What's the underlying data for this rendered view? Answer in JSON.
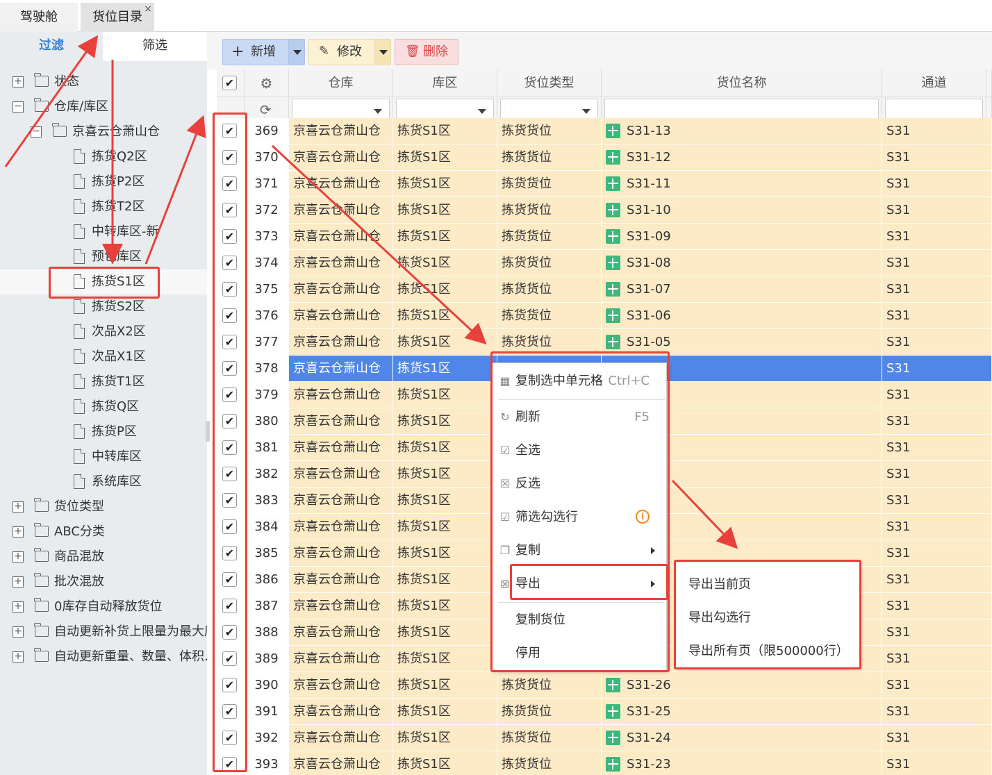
{
  "tabs": [
    {
      "label": "驾驶舱"
    },
    {
      "label": "货位目录",
      "close": "×"
    }
  ],
  "left_tabs": {
    "filter": "过滤",
    "screen": "筛选"
  },
  "tree": [
    {
      "label": "状态",
      "toggle": "⊞",
      "type": "folder",
      "level": 0
    },
    {
      "label": "仓库/库区",
      "toggle": "⊟",
      "type": "folder-open",
      "level": 0
    },
    {
      "label": "京喜云仓萧山仓",
      "toggle": "⊟",
      "type": "folder-open",
      "level": 1
    },
    {
      "label": "拣货Q2区",
      "type": "doc",
      "level": 2
    },
    {
      "label": "拣货P2区",
      "type": "doc",
      "level": 2
    },
    {
      "label": "拣货T2区",
      "type": "doc",
      "level": 2
    },
    {
      "label": "中转库区-新",
      "type": "doc",
      "level": 2
    },
    {
      "label": "预包库区",
      "type": "doc",
      "level": 2
    },
    {
      "label": "拣货S1区",
      "type": "doc",
      "level": 2,
      "selected": true
    },
    {
      "label": "拣货S2区",
      "type": "doc",
      "level": 2
    },
    {
      "label": "次品X2区",
      "type": "doc",
      "level": 2
    },
    {
      "label": "次品X1区",
      "type": "doc",
      "level": 2
    },
    {
      "label": "拣货T1区",
      "type": "doc",
      "level": 2
    },
    {
      "label": "拣货Q区",
      "type": "doc",
      "level": 2
    },
    {
      "label": "拣货P区",
      "type": "doc",
      "level": 2
    },
    {
      "label": "中转库区",
      "type": "doc",
      "level": 2
    },
    {
      "label": "系统库区",
      "type": "doc",
      "level": 2
    },
    {
      "label": "货位类型",
      "toggle": "⊞",
      "type": "folder",
      "level": 0
    },
    {
      "label": "ABC分类",
      "toggle": "⊞",
      "type": "folder",
      "level": 0
    },
    {
      "label": "商品混放",
      "toggle": "⊞",
      "type": "folder",
      "level": 0
    },
    {
      "label": "批次混放",
      "toggle": "⊞",
      "type": "folder",
      "level": 0
    },
    {
      "label": "0库存自动释放货位",
      "toggle": "⊞",
      "type": "folder",
      "level": 0
    },
    {
      "label": "自动更新补货上限量为最大库存",
      "toggle": "⊞",
      "type": "folder",
      "level": 0
    },
    {
      "label": "自动更新重量、数量、体积…",
      "toggle": "⊞",
      "type": "folder",
      "level": 0
    }
  ],
  "toolbar": {
    "add": "新增",
    "edit": "修改",
    "delete": "删除"
  },
  "columns": {
    "warehouse": "仓库",
    "zone": "库区",
    "slot_type": "货位类型",
    "slot_name": "货位名称",
    "channel": "通道"
  },
  "rows": [
    {
      "n": "369",
      "w": "京喜云仓萧山仓",
      "z": "拣货S1区",
      "t": "拣货货位",
      "name": "S31-13",
      "ch": "S31"
    },
    {
      "n": "370",
      "w": "京喜云仓萧山仓",
      "z": "拣货S1区",
      "t": "拣货货位",
      "name": "S31-12",
      "ch": "S31"
    },
    {
      "n": "371",
      "w": "京喜云仓萧山仓",
      "z": "拣货S1区",
      "t": "拣货货位",
      "name": "S31-11",
      "ch": "S31"
    },
    {
      "n": "372",
      "w": "京喜云仓萧山仓",
      "z": "拣货S1区",
      "t": "拣货货位",
      "name": "S31-10",
      "ch": "S31"
    },
    {
      "n": "373",
      "w": "京喜云仓萧山仓",
      "z": "拣货S1区",
      "t": "拣货货位",
      "name": "S31-09",
      "ch": "S31"
    },
    {
      "n": "374",
      "w": "京喜云仓萧山仓",
      "z": "拣货S1区",
      "t": "拣货货位",
      "name": "S31-08",
      "ch": "S31"
    },
    {
      "n": "375",
      "w": "京喜云仓萧山仓",
      "z": "拣货S1区",
      "t": "拣货货位",
      "name": "S31-07",
      "ch": "S31"
    },
    {
      "n": "376",
      "w": "京喜云仓萧山仓",
      "z": "拣货S1区",
      "t": "拣货货位",
      "name": "S31-06",
      "ch": "S31"
    },
    {
      "n": "377",
      "w": "京喜云仓萧山仓",
      "z": "拣货S1区",
      "t": "拣货货位",
      "name": "S31-05",
      "ch": "S31"
    },
    {
      "n": "378",
      "w": "京喜云仓萧山仓",
      "z": "拣货S1区",
      "t": "",
      "name": "",
      "ch": "S31",
      "highlight": true
    },
    {
      "n": "379",
      "w": "京喜云仓萧山仓",
      "z": "拣货S1区",
      "t": "",
      "name": "",
      "ch": "S31"
    },
    {
      "n": "380",
      "w": "京喜云仓萧山仓",
      "z": "拣货S1区",
      "t": "",
      "name": "",
      "ch": "S31"
    },
    {
      "n": "381",
      "w": "京喜云仓萧山仓",
      "z": "拣货S1区",
      "t": "",
      "name": "",
      "ch": "S31"
    },
    {
      "n": "382",
      "w": "京喜云仓萧山仓",
      "z": "拣货S1区",
      "t": "",
      "name": "",
      "ch": "S31"
    },
    {
      "n": "383",
      "w": "京喜云仓萧山仓",
      "z": "拣货S1区",
      "t": "",
      "name": "",
      "ch": "S31"
    },
    {
      "n": "384",
      "w": "京喜云仓萧山仓",
      "z": "拣货S1区",
      "t": "",
      "name": "",
      "ch": "S31"
    },
    {
      "n": "385",
      "w": "京喜云仓萧山仓",
      "z": "拣货S1区",
      "t": "",
      "name": "",
      "ch": "S31"
    },
    {
      "n": "386",
      "w": "京喜云仓萧山仓",
      "z": "拣货S1区",
      "t": "",
      "name": "",
      "ch": "S31"
    },
    {
      "n": "387",
      "w": "京喜云仓萧山仓",
      "z": "拣货S1区",
      "t": "",
      "name": "",
      "ch": "S31"
    },
    {
      "n": "388",
      "w": "京喜云仓萧山仓",
      "z": "拣货S1区",
      "t": "",
      "name": "",
      "ch": "S31"
    },
    {
      "n": "389",
      "w": "京喜云仓萧山仓",
      "z": "拣货S1区",
      "t": "",
      "name": "",
      "ch": "S31"
    },
    {
      "n": "390",
      "w": "京喜云仓萧山仓",
      "z": "拣货S1区",
      "t": "拣货货位",
      "name": "S31-26",
      "ch": "S31"
    },
    {
      "n": "391",
      "w": "京喜云仓萧山仓",
      "z": "拣货S1区",
      "t": "拣货货位",
      "name": "S31-25",
      "ch": "S31"
    },
    {
      "n": "392",
      "w": "京喜云仓萧山仓",
      "z": "拣货S1区",
      "t": "拣货货位",
      "name": "S31-24",
      "ch": "S31"
    },
    {
      "n": "393",
      "w": "京喜云仓萧山仓",
      "z": "拣货S1区",
      "t": "拣货货位",
      "name": "S31-23",
      "ch": "S31"
    }
  ],
  "context_menu": [
    {
      "label": "复制选中单元格",
      "shortcut": "Ctrl+C",
      "icon": "table-icon"
    },
    {
      "label": "刷新",
      "shortcut": "F5",
      "icon": "refresh-icon"
    },
    {
      "label": "全选",
      "icon": "select-all-icon"
    },
    {
      "label": "反选",
      "icon": "invert-select-icon"
    },
    {
      "label": "筛选勾选行",
      "icon": "filter-checked-icon",
      "info": "i"
    },
    {
      "label": "复制",
      "icon": "copy-icon",
      "submenu": true
    },
    {
      "label": "导出",
      "icon": "export-icon",
      "submenu": true
    },
    {
      "label": "复制货位"
    },
    {
      "label": "停用"
    }
  ],
  "export_submenu": [
    {
      "label": "导出当前页"
    },
    {
      "label": "导出勾选行"
    },
    {
      "label": "导出所有页（限500000行）"
    }
  ],
  "colors": {
    "accent": "#4f86e8",
    "row_bg": "#fdebc8",
    "annotation": "#e8413c"
  }
}
